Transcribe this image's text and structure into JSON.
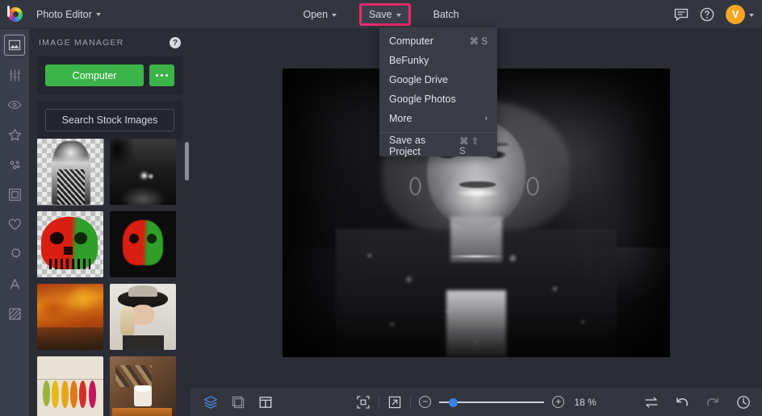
{
  "topbar": {
    "logo_icon": "befunky-logo-icon",
    "app_menu_label": "Photo Editor",
    "open_label": "Open",
    "save_label": "Save",
    "batch_label": "Batch",
    "feedback_icon": "speech-bubble-icon",
    "help_icon": "question-circle-icon",
    "avatar_initial": "V",
    "highlight_color": "#ec2a6d"
  },
  "rail": {
    "items": [
      {
        "icon": "image-icon",
        "active": true
      },
      {
        "icon": "sliders-icon",
        "active": false
      },
      {
        "icon": "eye-icon",
        "active": false
      },
      {
        "icon": "star-icon",
        "active": false
      },
      {
        "icon": "dots-cluster-icon",
        "active": false
      },
      {
        "icon": "frame-icon",
        "active": false
      },
      {
        "icon": "heart-icon",
        "active": false
      },
      {
        "icon": "badge-icon",
        "active": false
      },
      {
        "icon": "text-a-icon",
        "active": false
      },
      {
        "icon": "texture-icon",
        "active": false
      }
    ]
  },
  "panel": {
    "title": "IMAGE MANAGER",
    "help_icon": "question-circle-icon",
    "computer_label": "Computer",
    "more_options_icon": "ellipsis-icon",
    "search_stock_label": "Search Stock Images",
    "thumbnails": [
      {
        "name": "portrait-bw-transparent",
        "selected": true
      },
      {
        "name": "foggy-road-night",
        "selected": false
      },
      {
        "name": "skull-red-green-transparent",
        "selected": false
      },
      {
        "name": "skull-red-green-black",
        "selected": false
      },
      {
        "name": "autumn-forest",
        "selected": false
      },
      {
        "name": "woman-with-hat",
        "selected": false
      },
      {
        "name": "hanging-leaves",
        "selected": false
      },
      {
        "name": "cocoa-tray",
        "selected": false
      }
    ]
  },
  "save_menu": {
    "items": [
      {
        "label": "Computer",
        "shortcut": "⌘ S",
        "submenu": false
      },
      {
        "label": "BeFunky",
        "shortcut": "",
        "submenu": false
      },
      {
        "label": "Google Drive",
        "shortcut": "",
        "submenu": false
      },
      {
        "label": "Google Photos",
        "shortcut": "",
        "submenu": false
      },
      {
        "label": "More",
        "shortcut": "",
        "submenu": true
      }
    ],
    "footer": {
      "label": "Save as Project",
      "shortcut": "⌘ ⇧ S"
    },
    "submenu_arrow": "›"
  },
  "canvas": {
    "image_name": "portrait-over-forest-composite"
  },
  "bottombar": {
    "layers_icon": "layers-icon",
    "crop_icon": "crop-icon",
    "layout_icon": "layout-icon",
    "fit_icon": "fit-to-screen-icon",
    "fullscreen_icon": "expand-icon",
    "zoom_out_icon": "minus-icon",
    "zoom_in_icon": "plus-icon",
    "zoom_level": "18 %",
    "compare_icon": "compare-arrows-icon",
    "undo_icon": "undo-icon",
    "redo_icon": "redo-icon",
    "history_icon": "history-clock-icon",
    "slider_accent": "#3b82e8"
  }
}
